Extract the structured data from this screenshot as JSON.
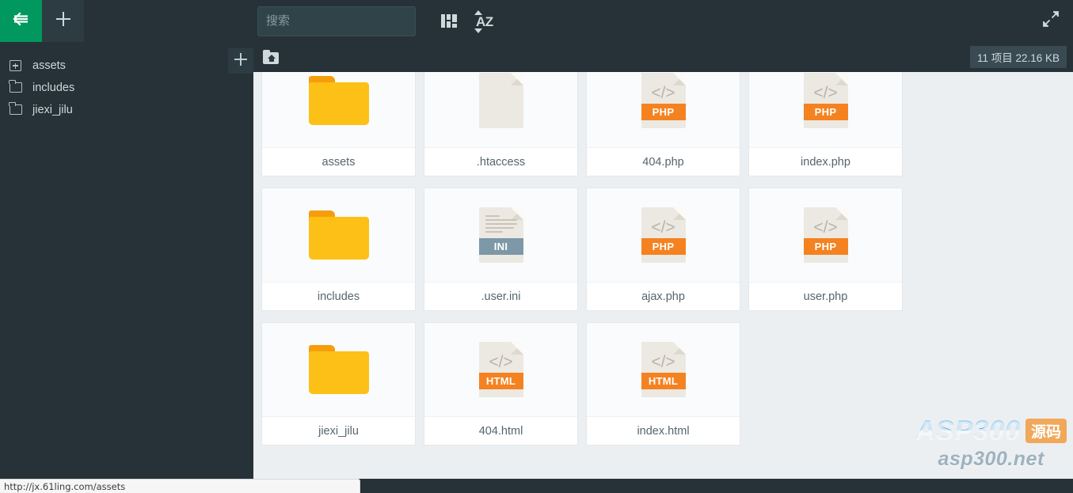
{
  "toolbar": {
    "back_icon": "back-arrow-icon",
    "add_icon": "plus-icon",
    "search": {
      "placeholder": "搜索",
      "value": ""
    },
    "view_toggle_label": "grid-view-icon",
    "sort_label": "AZ",
    "fullscreen_icon": "expand-icon"
  },
  "sidebar": {
    "add_button_label": "+",
    "items": [
      {
        "label": "assets",
        "icon": "folder-expandable-icon",
        "expandable": true
      },
      {
        "label": "includes",
        "icon": "folder-icon",
        "expandable": false
      },
      {
        "label": "jiexi_jilu",
        "icon": "folder-icon",
        "expandable": false
      }
    ]
  },
  "breadcrumb": {
    "home_icon": "home-folder-icon",
    "path": ""
  },
  "status": {
    "item_count_text": "11 项目  22.16 KB",
    "url": "http://jx.61ling.com/assets"
  },
  "files": [
    {
      "name": "assets",
      "type": "folder",
      "badge": ""
    },
    {
      "name": ".htaccess",
      "type": "blank",
      "badge": ""
    },
    {
      "name": "404.php",
      "type": "code",
      "badge": "PHP"
    },
    {
      "name": "index.php",
      "type": "code",
      "badge": "PHP"
    },
    {
      "name": "includes",
      "type": "folder",
      "badge": ""
    },
    {
      "name": ".user.ini",
      "type": "text",
      "badge": "INI"
    },
    {
      "name": "ajax.php",
      "type": "code",
      "badge": "PHP"
    },
    {
      "name": "user.php",
      "type": "code",
      "badge": "PHP"
    },
    {
      "name": "jiexi_jilu",
      "type": "folder",
      "badge": ""
    },
    {
      "name": "404.html",
      "type": "code",
      "badge": "HTML"
    },
    {
      "name": "index.html",
      "type": "code",
      "badge": "HTML"
    }
  ],
  "watermark": {
    "brand": "ASP300",
    "badge": "源码",
    "domain": "asp300.net"
  },
  "colors": {
    "chrome_dark": "#263238",
    "accent_green": "#00985f",
    "content_bg": "#eceff1",
    "folder_yellow": "#fdc016",
    "php_orange": "#f58220",
    "ini_slate": "#7d98a6"
  }
}
